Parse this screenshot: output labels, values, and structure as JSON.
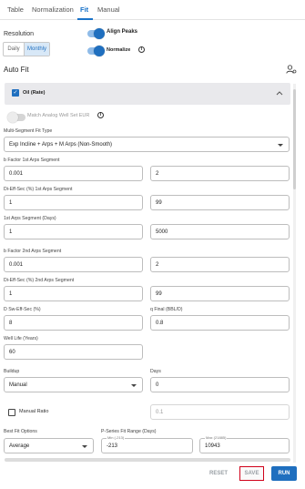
{
  "tabs": [
    "Table",
    "Normalization",
    "Fit",
    "Manual"
  ],
  "active_tab": "Fit",
  "align_peaks_label": "Align Peaks",
  "resolution": {
    "label": "Resolution",
    "options": [
      "Daily",
      "Monthly"
    ],
    "selected": "Monthly"
  },
  "normalize_label": "Normalize",
  "auto_fit": {
    "title": "Auto Fit"
  },
  "panel": {
    "title": "Oil (Rate)",
    "match_eur_label": "Match Analog Well Set EUR",
    "multi_segment": {
      "label": "Multi-Segment Fit Type",
      "value": "Exp Incline + Arps + M Arps (Non-Smooth)"
    },
    "b_factor_1": {
      "label": "b Factor 1st Arps Segment",
      "min": "0.001",
      "max": "2"
    },
    "di_eff_1": {
      "label": "Di-Eff-Sec (%) 1st Arps Segment",
      "min": "1",
      "max": "99"
    },
    "arps_days_1": {
      "label": "1st Arps Segment (Days)",
      "min": "1",
      "max": "5000"
    },
    "b_factor_2": {
      "label": "b Factor 2nd Arps Segment",
      "min": "0.001",
      "max": "2"
    },
    "di_eff_2": {
      "label": "Di-Eff-Sec (%) 2nd Arps Segment",
      "min": "1",
      "max": "99"
    },
    "d_sw": {
      "label": "D Sw-Eff-Sec (%)",
      "value": "8"
    },
    "q_final": {
      "label": "q Final (BBL/D)",
      "value": "0.8"
    },
    "well_life": {
      "label": "Well Life (Years)",
      "value": "60"
    },
    "buildup": {
      "label": "Buildup",
      "value": "Manual"
    },
    "days": {
      "label": "Days",
      "value": "0"
    },
    "manual_ratio": {
      "label": "Manual Ratio",
      "value": "0.1"
    },
    "best_fit": {
      "label": "Best Fit Options",
      "value": "Average"
    },
    "p_series": {
      "label": "P-Series Fit Range (Days)",
      "min_caption": "Min (-213)",
      "min": "-213",
      "max_caption": "Max (21885)",
      "max": "10943"
    }
  },
  "buttons": {
    "reset": "RESET",
    "save": "SAVE",
    "run": "RUN"
  },
  "colors": {
    "accent": "#1f6fbf",
    "highlight": "#d0021b"
  }
}
